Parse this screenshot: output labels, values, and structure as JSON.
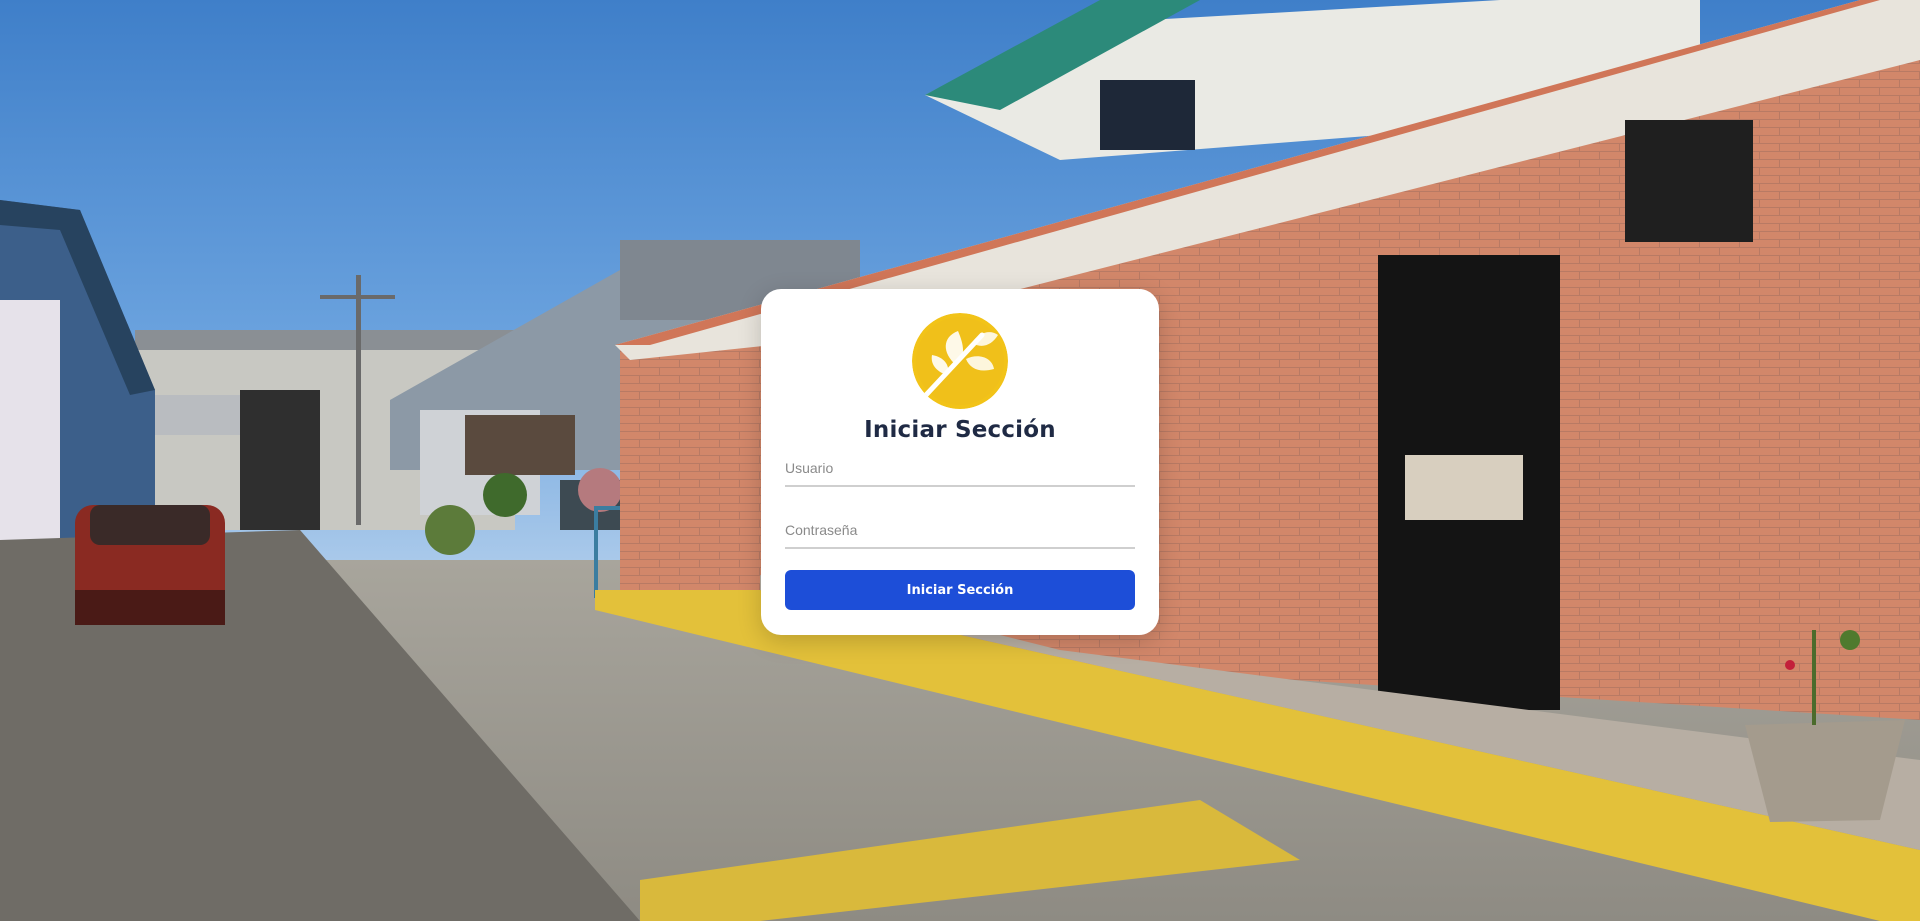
{
  "background": {
    "description_icon": "photo-background"
  },
  "login": {
    "logo_icon": "leaf-logo-icon",
    "title": "Iniciar Sección",
    "username_placeholder": "Usuario",
    "password_placeholder": "Contraseña",
    "submit_label": "Iniciar Sección"
  },
  "colors": {
    "accent": "#1d4ed8",
    "logo_yellow": "#f2c318",
    "title_text": "#1f2a44"
  }
}
